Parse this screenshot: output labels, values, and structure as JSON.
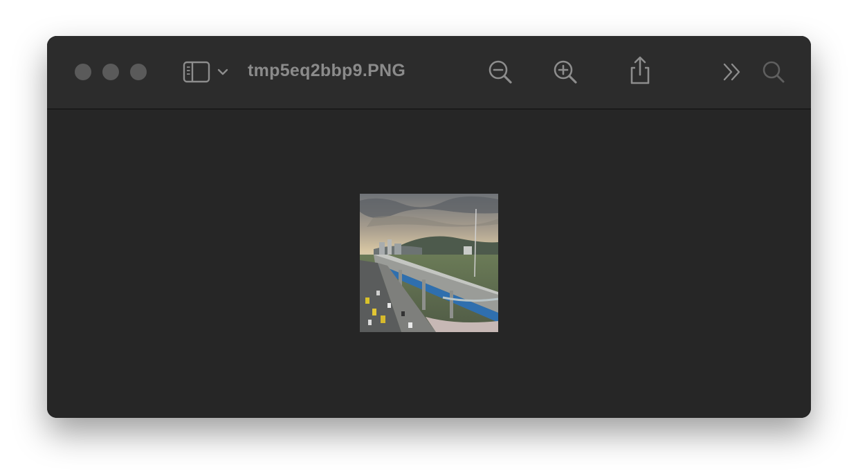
{
  "window": {
    "title": "tmp5eq2bbp9.PNG"
  },
  "toolbar": {
    "sidebar_toggle_icon": "sidebar-icon",
    "zoom_out_icon": "zoom-out-icon",
    "zoom_in_icon": "zoom-in-icon",
    "share_icon": "share-icon",
    "more_icon": "chevron-double-right-icon",
    "search_icon": "search-icon"
  },
  "colors": {
    "window_bg": "#282828",
    "titlebar_bg": "#2c2c2c",
    "title_text": "#8b8b8b",
    "icon": "#8d8d8d",
    "traffic_light": "#5a5a5a"
  }
}
